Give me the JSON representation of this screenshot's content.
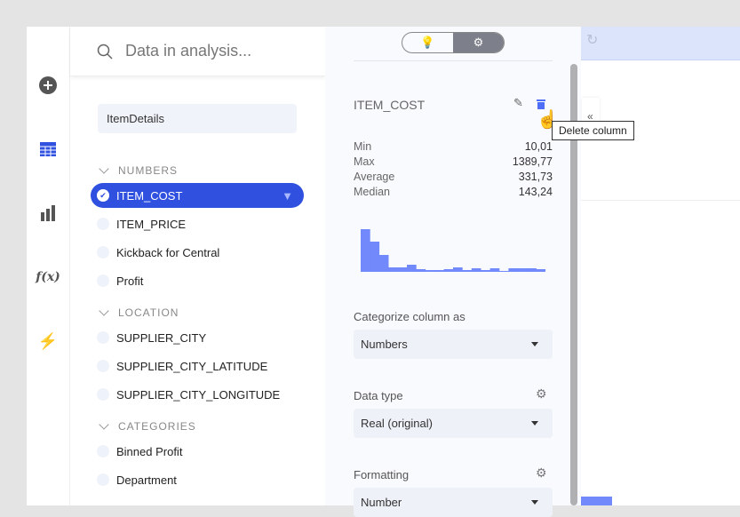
{
  "search": {
    "placeholder": "Data in analysis..."
  },
  "table_name": "ItemDetails",
  "sections": [
    {
      "title": "NUMBERS",
      "items": [
        "ITEM_COST",
        "ITEM_PRICE",
        "Kickback for Central",
        "Profit"
      ]
    },
    {
      "title": "LOCATION",
      "items": [
        "SUPPLIER_CITY",
        "SUPPLIER_CITY_LATITUDE",
        "SUPPLIER_CITY_LONGITUDE"
      ]
    },
    {
      "title": "CATEGORIES",
      "items": [
        "Binned Profit",
        "Department"
      ]
    }
  ],
  "selected_item": "ITEM_COST",
  "detail": {
    "column_name": "ITEM_COST",
    "stats": [
      {
        "label": "Min",
        "value": "10,01"
      },
      {
        "label": "Max",
        "value": "1389,77"
      },
      {
        "label": "Average",
        "value": "331,73"
      },
      {
        "label": "Median",
        "value": "143,24"
      }
    ],
    "histogram": [
      48,
      34,
      19,
      5,
      5,
      8,
      3,
      2,
      2,
      3,
      5,
      2,
      4,
      2,
      4,
      1,
      4,
      4,
      4,
      3
    ],
    "categorize_label": "Categorize column as",
    "categorize_value": "Numbers",
    "datatype_label": "Data type",
    "datatype_value": "Real (original)",
    "formatting_label": "Formatting",
    "formatting_value": "Number"
  },
  "tooltip": "Delete column",
  "colors": {
    "accent": "#3050e0",
    "histogram": "#7189fb"
  }
}
